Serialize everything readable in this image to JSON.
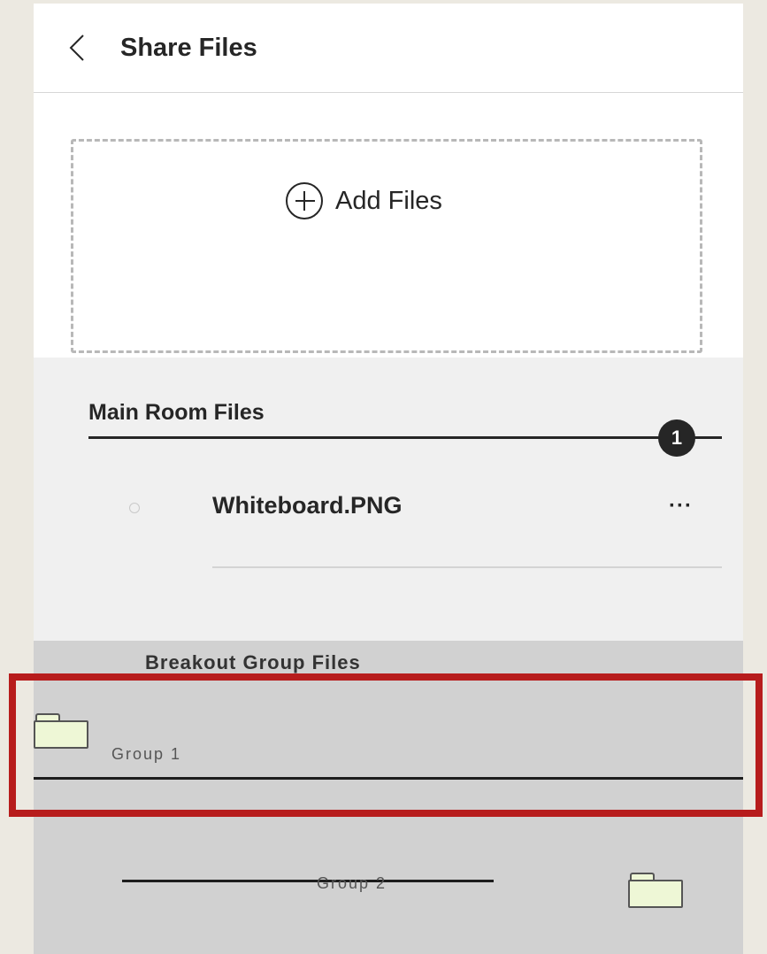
{
  "header": {
    "title": "Share Files"
  },
  "dropzone": {
    "add_label": "Add Files",
    "hint": ""
  },
  "main_room": {
    "title": "Main Room Files",
    "files": [
      {
        "name": "Whiteboard.PNG",
        "more": "···"
      }
    ]
  },
  "breakout": {
    "title": "Breakout Group Files",
    "groups": [
      {
        "label": "Group 1"
      },
      {
        "label": "Group 2"
      }
    ],
    "badge": "1"
  },
  "colors": {
    "highlight": "#b71c1c",
    "accent": "#262626",
    "background": "#ece9e1"
  }
}
